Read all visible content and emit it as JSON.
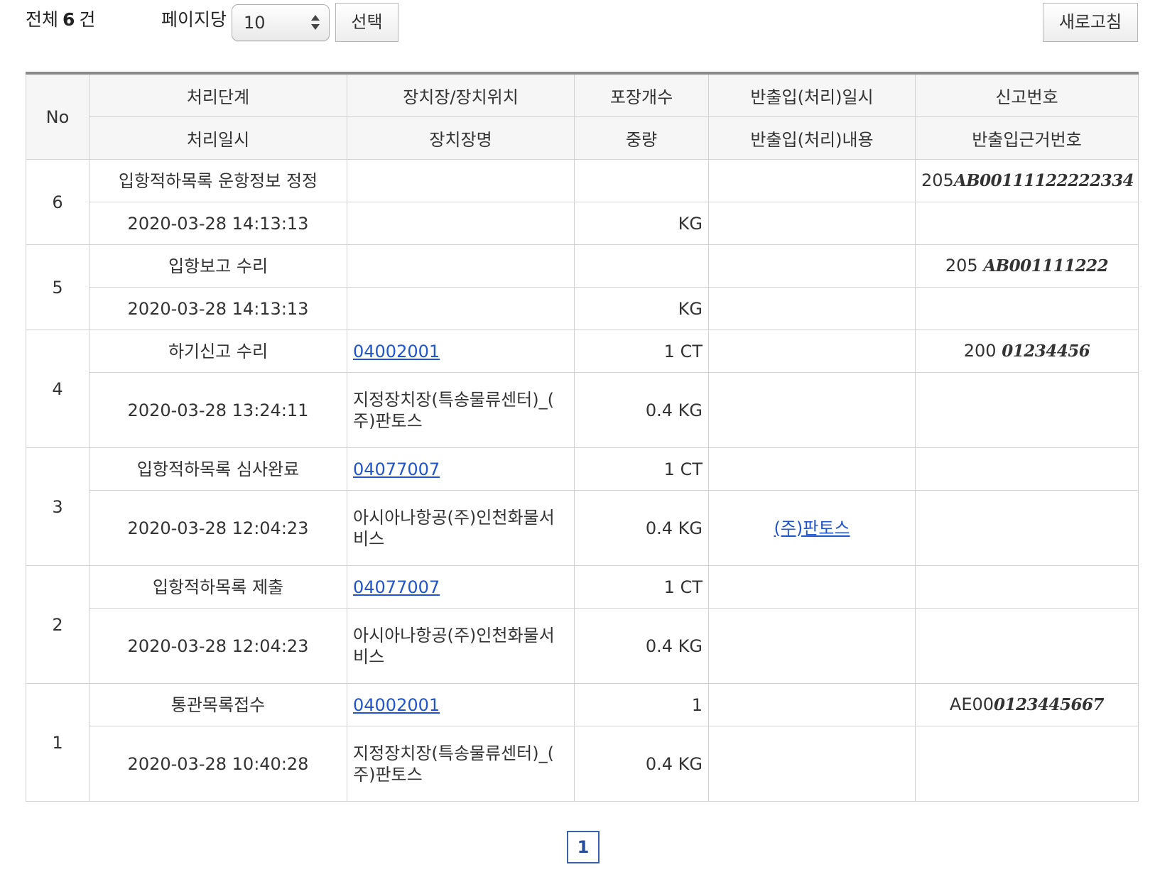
{
  "toolbar": {
    "total_prefix": "전체",
    "total_count": "6",
    "total_suffix": "건",
    "per_page_label": "페이지당",
    "per_page_value": "10",
    "select_button": "선택",
    "refresh_button": "새로고침"
  },
  "table": {
    "header_row1": {
      "no": "No",
      "stage": "처리단계",
      "location": "장치장/장치위치",
      "packages": "포장개수",
      "inout_datetime": "반출입(처리)일시",
      "report_no": "신고번호"
    },
    "header_row2": {
      "processed_at": "처리일시",
      "location_name": "장치장명",
      "weight": "중량",
      "inout_content": "반출입(처리)내용",
      "basis_no": "반출입근거번호"
    },
    "rows": [
      {
        "no": "6",
        "stage": "입항적하목록 운항정보 정정",
        "location_code": "",
        "packages": "",
        "inout_datetime": "",
        "report_no_prefix": "205",
        "report_no_hand": "AB00111122222334",
        "processed_at": "2020-03-28 14:13:13",
        "location_name": "",
        "weight": "KG",
        "inout_content": "",
        "basis_no": ""
      },
      {
        "no": "5",
        "stage": "입항보고 수리",
        "location_code": "",
        "packages": "",
        "inout_datetime": "",
        "report_no_prefix": "205",
        "report_no_hand": "AB001111222",
        "processed_at": "2020-03-28 14:13:13",
        "location_name": "",
        "weight": "KG",
        "inout_content": "",
        "basis_no": ""
      },
      {
        "no": "4",
        "stage": "하기신고 수리",
        "location_code": "04002001",
        "packages": "1 CT",
        "inout_datetime": "",
        "report_no_prefix": "200",
        "report_no_hand": "01234456",
        "processed_at": "2020-03-28 13:24:11",
        "location_name_line1": "지정장치장(특송물류센터)_(",
        "location_name_line2": "주)판토스",
        "weight": "0.4 KG",
        "inout_content": "",
        "basis_no": ""
      },
      {
        "no": "3",
        "stage": "입항적하목록 심사완료",
        "location_code": "04077007",
        "packages": "1 CT",
        "inout_datetime": "",
        "report_no_prefix": "",
        "report_no_hand": "",
        "processed_at": "2020-03-28 12:04:23",
        "location_name_line1": "아시아나항공(주)인천화물서",
        "location_name_line2": "비스",
        "weight": "0.4 KG",
        "inout_content": "(주)판토스",
        "basis_no": ""
      },
      {
        "no": "2",
        "stage": "입항적하목록 제출",
        "location_code": "04077007",
        "packages": "1 CT",
        "inout_datetime": "",
        "report_no_prefix": "",
        "report_no_hand": "",
        "processed_at": "2020-03-28 12:04:23",
        "location_name_line1": "아시아나항공(주)인천화물서",
        "location_name_line2": "비스",
        "weight": "0.4 KG",
        "inout_content": "",
        "basis_no": ""
      },
      {
        "no": "1",
        "stage": "통관목록접수",
        "location_code": "04002001",
        "packages": "1",
        "inout_datetime": "",
        "report_no_prefix": "AE00",
        "report_no_hand": "0123445667",
        "processed_at": "2020-03-28 10:40:28",
        "location_name_line1": "지정장치장(특송물류센터)_(",
        "location_name_line2": "주)판토스",
        "weight": "0.4 KG",
        "inout_content": "",
        "basis_no": ""
      }
    ]
  },
  "pagination": {
    "current_page": "1"
  },
  "colors": {
    "link": "#2255cc",
    "header_bg": "#f6f6f6",
    "border": "#d2d2d2",
    "pager_border": "#3a62a8"
  }
}
